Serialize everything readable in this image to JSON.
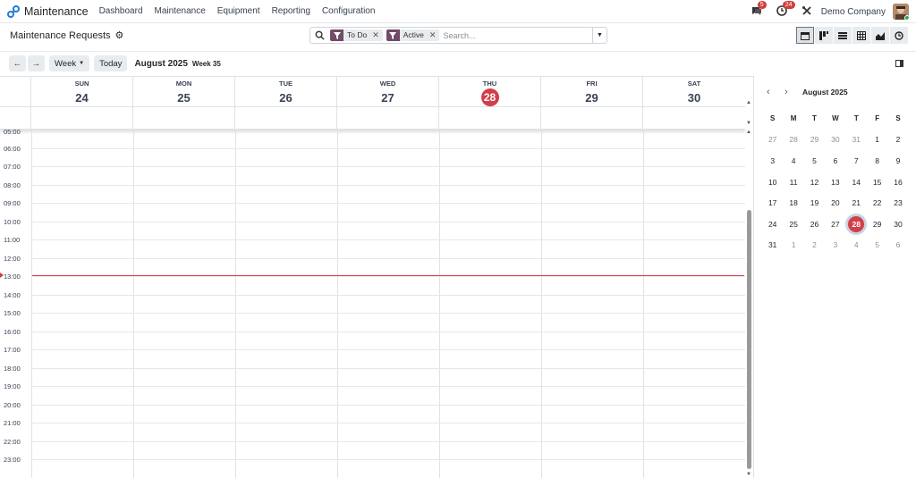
{
  "navbar": {
    "app_name": "Maintenance",
    "menu": [
      "Dashboard",
      "Maintenance",
      "Equipment",
      "Reporting",
      "Configuration"
    ],
    "messages_badge": "5",
    "activities_badge": "24",
    "company": "Demo Company"
  },
  "control_panel": {
    "title": "Maintenance Requests",
    "facets": [
      "To Do",
      "Active"
    ],
    "search_placeholder": "Search..."
  },
  "toolbar": {
    "scale_label": "Week",
    "today_label": "Today",
    "range": "August 2025",
    "week": "Week 35"
  },
  "week_view": {
    "days": [
      {
        "name": "SUN",
        "num": "24"
      },
      {
        "name": "MON",
        "num": "25"
      },
      {
        "name": "TUE",
        "num": "26"
      },
      {
        "name": "WED",
        "num": "27"
      },
      {
        "name": "THU",
        "num": "28",
        "today": true
      },
      {
        "name": "FRI",
        "num": "29"
      },
      {
        "name": "SAT",
        "num": "30"
      }
    ],
    "hours": [
      "05:00",
      "06:00",
      "07:00",
      "08:00",
      "09:00",
      "10:00",
      "11:00",
      "12:00",
      "13:00",
      "14:00",
      "15:00",
      "16:00",
      "17:00",
      "18:00",
      "19:00",
      "20:00",
      "21:00",
      "22:00",
      "23:00"
    ]
  },
  "mini_calendar": {
    "title": "August 2025",
    "weekdays": [
      "S",
      "M",
      "T",
      "W",
      "T",
      "F",
      "S"
    ],
    "weeks": [
      [
        [
          "27",
          1
        ],
        [
          "28",
          1
        ],
        [
          "29",
          1
        ],
        [
          "30",
          1
        ],
        [
          "31",
          1
        ],
        [
          "1",
          0
        ],
        [
          "2",
          0
        ]
      ],
      [
        [
          "3",
          0
        ],
        [
          "4",
          0
        ],
        [
          "5",
          0
        ],
        [
          "6",
          0
        ],
        [
          "7",
          0
        ],
        [
          "8",
          0
        ],
        [
          "9",
          0
        ]
      ],
      [
        [
          "10",
          0
        ],
        [
          "11",
          0
        ],
        [
          "12",
          0
        ],
        [
          "13",
          0
        ],
        [
          "14",
          0
        ],
        [
          "15",
          0
        ],
        [
          "16",
          0
        ]
      ],
      [
        [
          "17",
          0
        ],
        [
          "18",
          0
        ],
        [
          "19",
          0
        ],
        [
          "20",
          0
        ],
        [
          "21",
          0
        ],
        [
          "22",
          0
        ],
        [
          "23",
          0
        ]
      ],
      [
        [
          "24",
          0
        ],
        [
          "25",
          0
        ],
        [
          "26",
          0
        ],
        [
          "27",
          0
        ],
        [
          "28",
          2
        ],
        [
          "29",
          0
        ],
        [
          "30",
          0
        ]
      ],
      [
        [
          "31",
          0
        ],
        [
          "1",
          1
        ],
        [
          "2",
          1
        ],
        [
          "3",
          1
        ],
        [
          "4",
          1
        ],
        [
          "5",
          1
        ],
        [
          "6",
          1
        ]
      ]
    ]
  },
  "colors": {
    "accent": "#714b67",
    "today": "#d23f4b",
    "now_line": "#e03e4b"
  }
}
